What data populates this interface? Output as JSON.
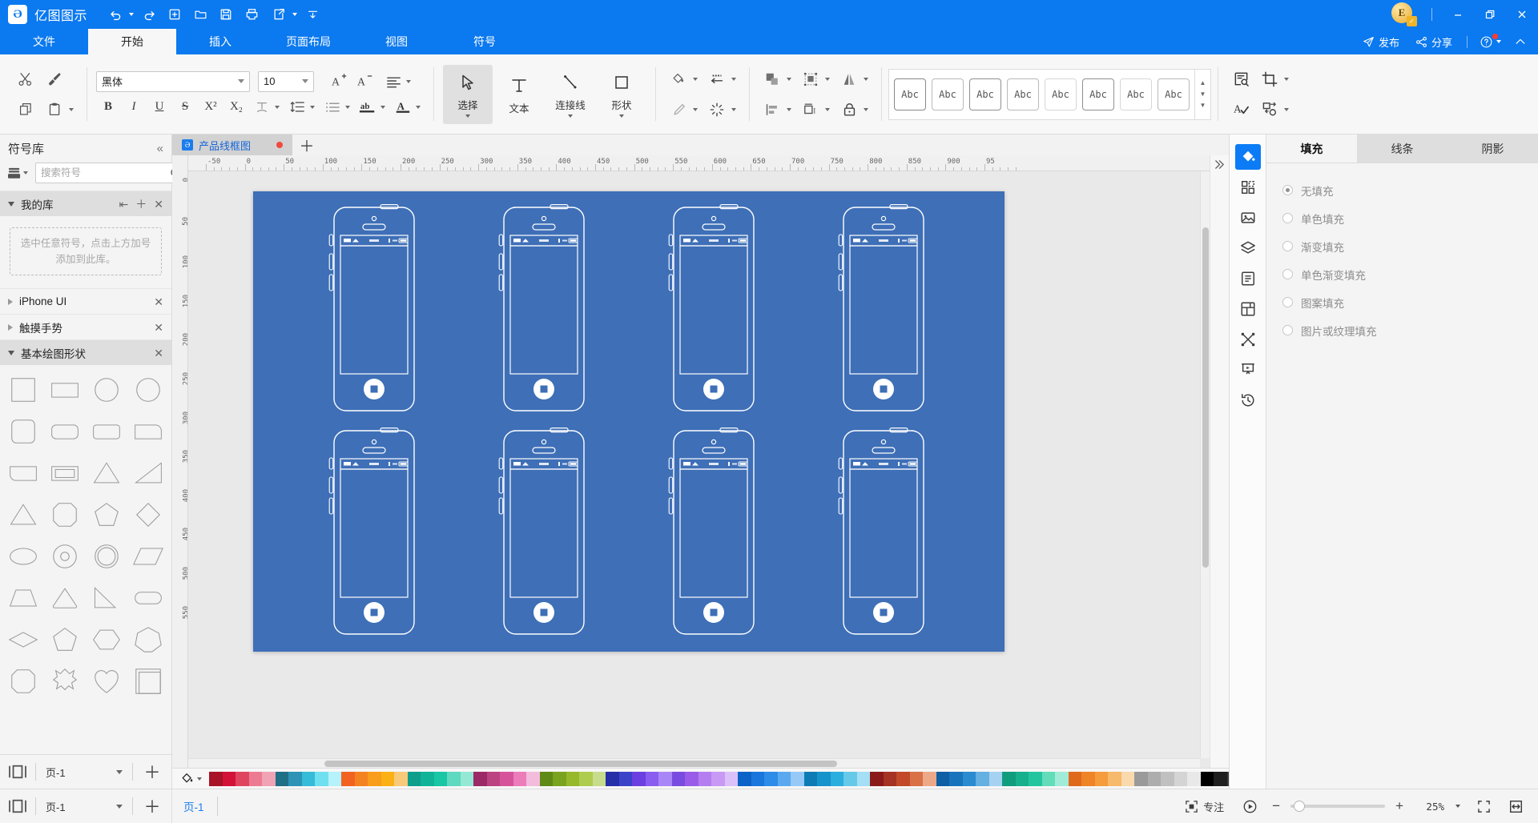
{
  "titlebar": {
    "app_name": "亿图图示",
    "logo_glyph": "Ə",
    "quick_actions": [
      {
        "name": "undo",
        "label": "撤销"
      },
      {
        "name": "redo",
        "label": "重做"
      },
      {
        "name": "new",
        "label": "新建"
      },
      {
        "name": "open",
        "label": "打开"
      },
      {
        "name": "save",
        "label": "保存"
      },
      {
        "name": "print",
        "label": "打印"
      },
      {
        "name": "export",
        "label": "导出"
      },
      {
        "name": "customize",
        "label": "自定义"
      }
    ],
    "avatar_letter": "E",
    "window_controls": {
      "minimize": "–",
      "maximize": "❐",
      "close": "✕"
    }
  },
  "menubar": {
    "tabs": [
      {
        "label": "文件",
        "active": false
      },
      {
        "label": "开始",
        "active": true
      },
      {
        "label": "插入",
        "active": false
      },
      {
        "label": "页面布局",
        "active": false
      },
      {
        "label": "视图",
        "active": false
      },
      {
        "label": "符号",
        "active": false
      }
    ],
    "publish_label": "发布",
    "share_label": "分享"
  },
  "ribbon": {
    "clipboard": {
      "cut_label": "剪切",
      "format_painter_label": "格式刷",
      "copy_label": "复制",
      "paste_label": "粘贴"
    },
    "font": {
      "family": "黑体",
      "size": "10",
      "bold": "B",
      "italic": "I",
      "underline": "U",
      "strikethrough": "S",
      "superscript": "X²",
      "subscript": "X₂"
    },
    "tools": [
      {
        "label": "选择",
        "icon": "cursor-icon",
        "active": true,
        "has_caret": true
      },
      {
        "label": "文本",
        "icon": "text-icon",
        "active": false,
        "has_caret": false
      },
      {
        "label": "连接线",
        "icon": "connector-icon",
        "active": false,
        "has_caret": true
      },
      {
        "label": "形状",
        "icon": "shape-icon",
        "active": false,
        "has_caret": true
      }
    ],
    "style_gallery": {
      "items": [
        "Abc",
        "Abc",
        "Abc",
        "Abc",
        "Abc",
        "Abc",
        "Abc",
        "Abc"
      ]
    }
  },
  "left_panel": {
    "title": "符号库",
    "search_placeholder": "搜索符号",
    "search_value": "",
    "sections": [
      {
        "label": "我的库",
        "open": true,
        "empty_hint": "选中任意符号，点击上方加号添加到此库。"
      },
      {
        "label": "iPhone UI",
        "open": false
      },
      {
        "label": "触摸手势",
        "open": false
      },
      {
        "label": "基本绘图形状",
        "open": true
      }
    ],
    "shapes": [
      "square",
      "rectangle",
      "circle",
      "circle",
      "rounded-square",
      "rounded-rect",
      "rounded-rect2",
      "one-round-corner",
      "corner-round",
      "double-rect",
      "triangle",
      "right-triangle",
      "triangle2",
      "octagon",
      "pentagon",
      "diamond-left",
      "ellipse",
      "donut",
      "ring",
      "parallelogram",
      "trapezoid",
      "rounded-triangle",
      "right-triangle2",
      "capsule",
      "rhombus",
      "pentagon2",
      "hexagon",
      "heptagon",
      "octagon2",
      "star-burst",
      "heart",
      "frame"
    ],
    "footer": {
      "page_label": "页-1"
    }
  },
  "canvas": {
    "document_tab": "产品线框图",
    "modified": true,
    "ruler_h_ticks": [
      "-50",
      "0",
      "50",
      "100",
      "150",
      "200",
      "250",
      "300",
      "350",
      "400",
      "450",
      "500",
      "550",
      "600",
      "650",
      "700",
      "750",
      "800",
      "850",
      "900",
      "95"
    ],
    "ruler_v_ticks": [
      "0",
      "50",
      "100",
      "150",
      "200",
      "250",
      "300",
      "350",
      "400",
      "450",
      "500",
      "550"
    ],
    "page_background": "#3e6fb7",
    "phone_count": 8
  },
  "right_panel": {
    "tabs": [
      {
        "label": "填充",
        "active": true
      },
      {
        "label": "线条",
        "active": false
      },
      {
        "label": "阴影",
        "active": false
      }
    ],
    "fill_options": [
      {
        "label": "无填充",
        "selected": true
      },
      {
        "label": "单色填充",
        "selected": false
      },
      {
        "label": "渐变填充",
        "selected": false
      },
      {
        "label": "单色渐变填充",
        "selected": false
      },
      {
        "label": "图案填充",
        "selected": false
      },
      {
        "label": "图片或纹理填充",
        "selected": false
      }
    ],
    "rail_icons": [
      {
        "name": "fill-icon",
        "active": true
      },
      {
        "name": "grid-apps-icon",
        "active": false
      },
      {
        "name": "image-icon",
        "active": false
      },
      {
        "name": "layers-icon",
        "active": false
      },
      {
        "name": "properties-icon",
        "active": false
      },
      {
        "name": "containers-icon",
        "active": false
      },
      {
        "name": "connect-points-icon",
        "active": false
      },
      {
        "name": "presentation-icon",
        "active": false
      },
      {
        "name": "history-icon",
        "active": false
      }
    ]
  },
  "statusbar": {
    "page_label": "页-1",
    "focus_label": "专注",
    "zoom_percent": "25%",
    "minus": "−",
    "plus": "+"
  },
  "palette": {
    "colors": [
      "#a81328",
      "#d31237",
      "#e0455f",
      "#ec7b92",
      "#f0a3b5",
      "#1f6f86",
      "#2e93b5",
      "#36bcd8",
      "#6fe0ef",
      "#b6f2fb",
      "#f26322",
      "#f58220",
      "#f99d1c",
      "#fbb116",
      "#f9c97a",
      "#0f9e8c",
      "#10b398",
      "#19c6a5",
      "#5fd9bf",
      "#95e8d4",
      "#9c2a66",
      "#bc4382",
      "#d6539c",
      "#ed7cbb",
      "#f3bcdd",
      "#5f8a16",
      "#7aa41f",
      "#95b92a",
      "#aecd4e",
      "#c8dd8c",
      "#252fa8",
      "#3b44c9",
      "#6b3fe0",
      "#8a5cf0",
      "#a986f7",
      "#7a4be0",
      "#9a5ce8",
      "#b47ef0",
      "#c99af5",
      "#dcc0fa",
      "#0c63c7",
      "#1a76dd",
      "#2d8ce8",
      "#5aa9f0",
      "#96c9f7",
      "#0f7bb5",
      "#1793cc",
      "#2aaede",
      "#66c9ea",
      "#a4dff5",
      "#8a1a1a",
      "#a53222",
      "#c24a2a",
      "#d97147",
      "#eda987",
      "#0e5fa4",
      "#1873bd",
      "#2b8bd0",
      "#64b0e2",
      "#a5d2f0",
      "#0f9d7e",
      "#16b08d",
      "#23c59e",
      "#63dcba",
      "#a0ecd8",
      "#e06a1c",
      "#ef8427",
      "#f59c3c",
      "#f7b96b",
      "#fad9ac",
      "#9a9a9a",
      "#adadad",
      "#c0c0c0",
      "#d4d4d4",
      "#e8e8e8",
      "#000000",
      "#1f1f1f",
      "#3a3a3a",
      "#555555",
      "#707070",
      "#8a8a8a",
      "#a4a4a4",
      "#bfbfbf",
      "#d9d9d9",
      "#f2f2f2"
    ]
  }
}
